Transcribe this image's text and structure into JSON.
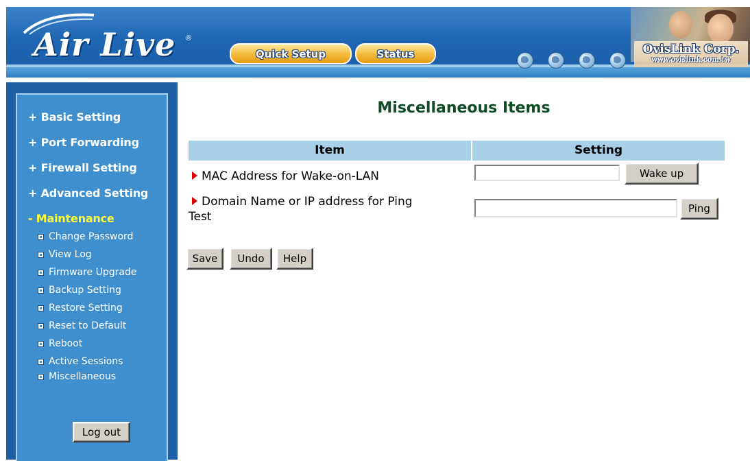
{
  "header": {
    "logo_text": "Air Live",
    "logo_mark": "®",
    "buttons": {
      "quick_setup": "Quick Setup",
      "status": "Status"
    },
    "corp_name": "OvisLink Corp.",
    "corp_url": "www.ovislink.com.tw"
  },
  "sidebar": {
    "menus": [
      {
        "label": "+ Basic Setting"
      },
      {
        "label": "+ Port Forwarding"
      },
      {
        "label": "+ Firewall Setting"
      },
      {
        "label": "+ Advanced Setting"
      },
      {
        "label": "- Maintenance"
      }
    ],
    "maintenance_items": [
      {
        "label": "Change Password"
      },
      {
        "label": "View Log"
      },
      {
        "label": "Firmware Upgrade"
      },
      {
        "label": "Backup Setting"
      },
      {
        "label": "Restore Setting"
      },
      {
        "label": "Reset to Default"
      },
      {
        "label": "Reboot"
      },
      {
        "label": "Active Sessions"
      },
      {
        "label": "Miscellaneous"
      }
    ],
    "logout_label": "Log out"
  },
  "main": {
    "title": "Miscellaneous Items",
    "table": {
      "col_item": "Item",
      "col_setting": "Setting",
      "rows": [
        {
          "label": "MAC Address for Wake-on-LAN",
          "value": "",
          "button": "Wake up"
        },
        {
          "label_line1": "Domain Name or IP address for Ping",
          "label_line2": "Test",
          "value": "",
          "button": "Ping"
        }
      ]
    },
    "actions": {
      "save": "Save",
      "undo": "Undo",
      "help": "Help"
    }
  },
  "colors": {
    "banner_blue": "#1f66b3",
    "sidebar_blue": "#3f8fcf",
    "sidebar_frame": "#1f5fa3",
    "active_menu": "#ffff33",
    "table_header": "#a8d0e6",
    "title_green": "#0f4b24",
    "bullet_red": "#d40000"
  }
}
